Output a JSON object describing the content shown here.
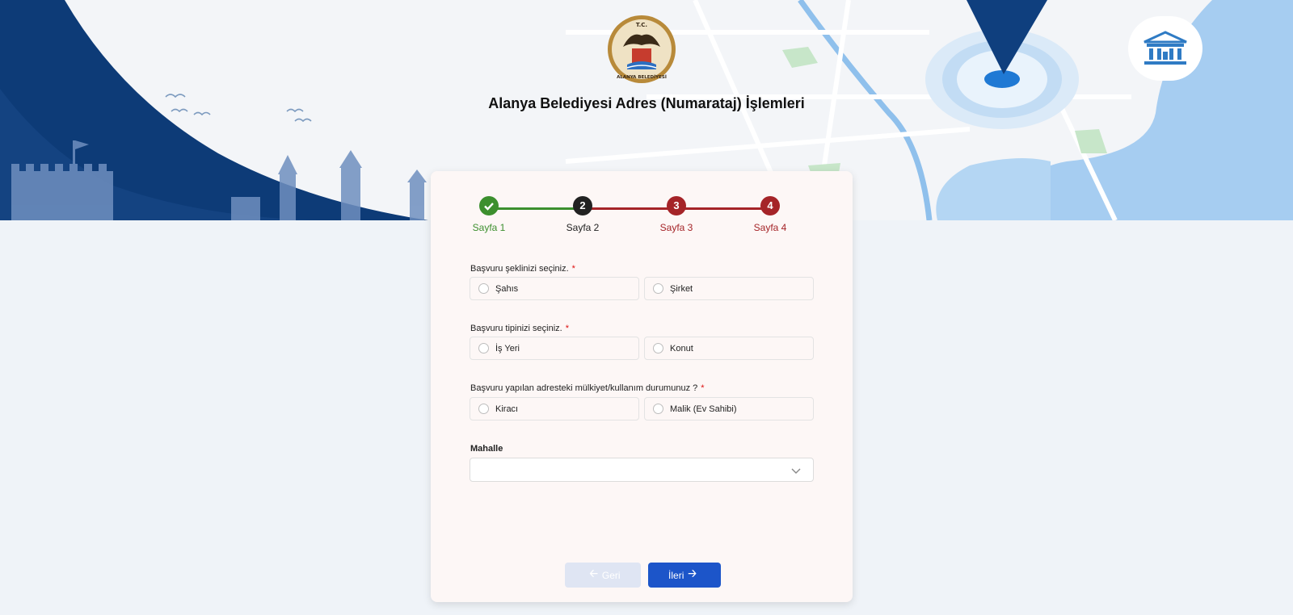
{
  "header": {
    "title": "Alanya Belediyesi Adres (Numarataj) İşlemleri",
    "logo_text_top": "T.C.",
    "logo_text_bottom": "ALANYA BELEDİYESİ"
  },
  "icons": {
    "logo": "municipality-seal-icon",
    "museum": "government-building-icon",
    "pin": "map-pin-icon",
    "check": "check-icon",
    "chevron": "chevron-down-icon",
    "arrow_left": "arrow-left-icon",
    "arrow_right": "arrow-right-icon"
  },
  "colors": {
    "step_done": "#3c8f2e",
    "step_current": "#222222",
    "step_pending": "#a52428",
    "primary_button": "#1c55c9",
    "disabled_button": "#dfe5f3",
    "hero_navy": "#0d3b77",
    "map_water": "#a6cdf1"
  },
  "stepper": {
    "steps": [
      {
        "number": "",
        "label": "Sayfa 1",
        "state": "done"
      },
      {
        "number": "2",
        "label": "Sayfa 2",
        "state": "current"
      },
      {
        "number": "3",
        "label": "Sayfa 3",
        "state": "pending"
      },
      {
        "number": "4",
        "label": "Sayfa 4",
        "state": "pending"
      }
    ]
  },
  "form": {
    "basvuru_sekli": {
      "label": "Başvuru şeklinizi seçiniz.",
      "required_mark": "*",
      "options": [
        "Şahıs",
        "Şirket"
      ]
    },
    "basvuru_tipi": {
      "label": "Başvuru tipinizi seçiniz.",
      "required_mark": "*",
      "options": [
        "İş Yeri",
        "Konut"
      ]
    },
    "mulkiyet": {
      "label": "Başvuru yapılan adresteki mülkiyet/kullanım durumunuz ?",
      "required_mark": "*",
      "options": [
        "Kiracı",
        "Malik (Ev Sahibi)"
      ]
    },
    "mahalle": {
      "label": "Mahalle",
      "value": ""
    }
  },
  "buttons": {
    "back": "Geri",
    "next": "İleri"
  }
}
